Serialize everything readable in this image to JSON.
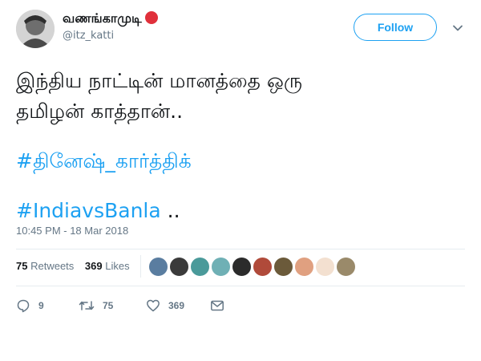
{
  "user": {
    "display_name": "வணங்காமுடி",
    "handle": "@itz_katti",
    "avatar_icon": "avatar-photo",
    "badge_color": "#e0303b"
  },
  "follow_button": {
    "label": "Follow",
    "color": "#1da1f2"
  },
  "menu_icon": "chevron-down-icon",
  "tweet": {
    "line1": "இந்திய நாட்டின் மானத்தை ஒரு",
    "line2": "தமிழன் காத்தான்..",
    "hashtag1": "#தினேஷ்_கார்த்திக்",
    "hashtag2": "#IndiavsBanla",
    "trailing": " .."
  },
  "timestamp": "10:45 PM - 18 Mar 2018",
  "stats": {
    "retweets_count": "75",
    "retweets_label": "Retweets",
    "likes_count": "369",
    "likes_label": "Likes"
  },
  "liker_avatars": [
    {
      "name": "liker-1",
      "color": "#5a7da0"
    },
    {
      "name": "liker-2",
      "color": "#3b3b3b"
    },
    {
      "name": "liker-3",
      "color": "#4a9a9a"
    },
    {
      "name": "liker-4",
      "color": "#6fb0b5"
    },
    {
      "name": "liker-5",
      "color": "#2b2b2b"
    },
    {
      "name": "liker-6",
      "color": "#b04a3a"
    },
    {
      "name": "liker-7",
      "color": "#6b5a3a"
    },
    {
      "name": "liker-8",
      "color": "#e0a080"
    },
    {
      "name": "liker-9",
      "color": "#f3e0d0"
    },
    {
      "name": "liker-10",
      "color": "#9a8a6a"
    }
  ],
  "actions": {
    "reply_count": "9",
    "retweet_count": "75",
    "like_count": "369",
    "reply_icon": "reply-icon",
    "retweet_icon": "retweet-icon",
    "like_icon": "heart-icon",
    "dm_icon": "envelope-icon"
  },
  "colors": {
    "accent": "#1da1f2",
    "muted": "#657786",
    "text": "#14171a"
  }
}
